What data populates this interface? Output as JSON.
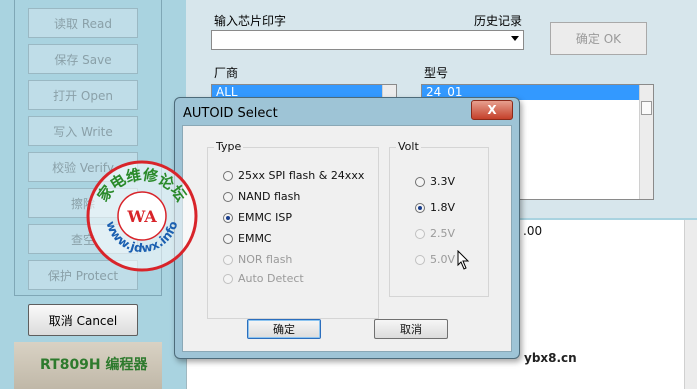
{
  "left_buttons": [
    {
      "label": "读取 Read"
    },
    {
      "label": "保存 Save"
    },
    {
      "label": "打开 Open"
    },
    {
      "label": "写入 Write"
    },
    {
      "label": "校验 Verify"
    },
    {
      "label": "擦除"
    },
    {
      "label": "查空"
    },
    {
      "label": "保护 Protect"
    }
  ],
  "cancel_label": "取消 Cancel",
  "device_label": "RT809H 编程器",
  "main": {
    "chip_label": "输入芯片印字",
    "history_label": "历史记录",
    "chip_value": "",
    "ok_label": "确定 OK",
    "vendor_label": "厂商",
    "vendor_selected": "ALL",
    "model_label": "型号",
    "model_selected": "24_01",
    "log_fragment": ".00"
  },
  "dialog": {
    "title": "AUTOID Select",
    "close_label": "X",
    "type_label": "Type",
    "type_options": [
      {
        "label": "25xx SPI flash & 24xxx",
        "selected": false,
        "disabled": false
      },
      {
        "label": "NAND flash",
        "selected": false,
        "disabled": false
      },
      {
        "label": "EMMC ISP",
        "selected": true,
        "disabled": false
      },
      {
        "label": "EMMC",
        "selected": false,
        "disabled": false
      },
      {
        "label": "NOR flash",
        "selected": false,
        "disabled": true
      },
      {
        "label": "Auto Detect",
        "selected": false,
        "disabled": true
      }
    ],
    "volt_label": "Volt",
    "volt_options": [
      {
        "label": "3.3V",
        "selected": false,
        "disabled": false
      },
      {
        "label": "1.8V",
        "selected": true,
        "disabled": false
      },
      {
        "label": "2.5V",
        "selected": false,
        "disabled": true
      },
      {
        "label": "5.0V",
        "selected": false,
        "disabled": true
      }
    ],
    "ok_label": "确定",
    "cancel_label": "取消"
  },
  "watermark": {
    "text_top": "家电维修论坛",
    "text_bottom": "www.jdwx.info",
    "logo": "WA"
  },
  "site_footer": "ybx8.cn",
  "colors": {
    "selection": "#3399ff",
    "watermark_red": "#d8242a",
    "brand_green": "#2d7a2d"
  }
}
